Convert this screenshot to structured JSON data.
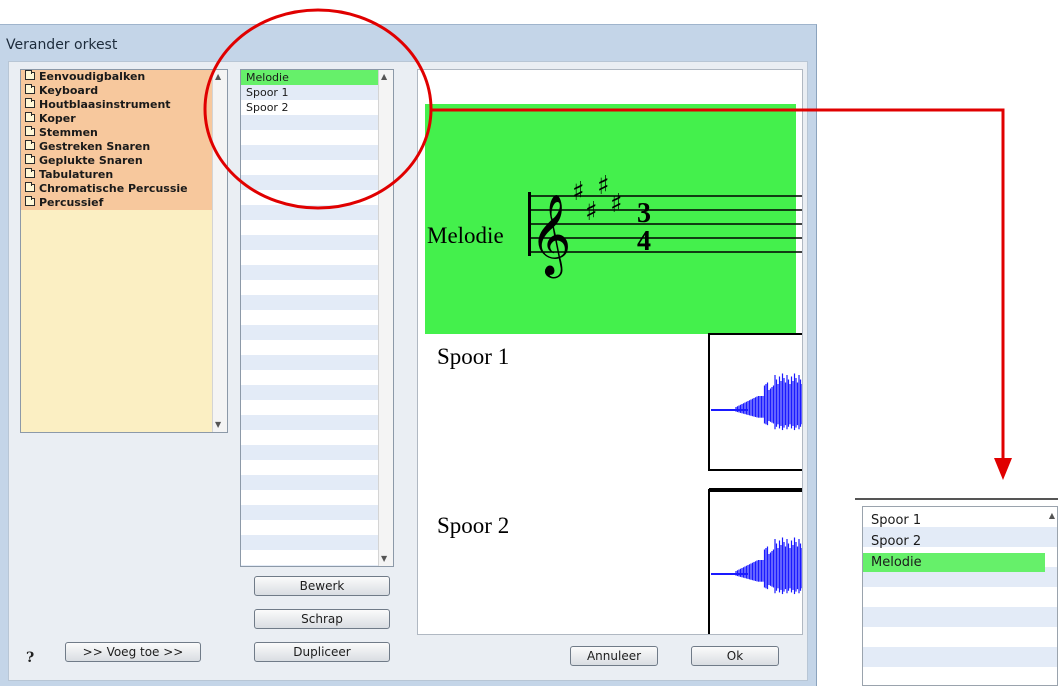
{
  "window": {
    "title": "Verander orkest"
  },
  "categories": [
    "Eenvoudigbalken",
    "Keyboard",
    "Houtblaasinstrument",
    "Koper",
    "Stemmen",
    "Gestreken Snaren",
    "Geplukte Snaren",
    "Tabulaturen",
    "Chromatische Percussie",
    "Percussief"
  ],
  "tracks": [
    {
      "label": "Melodie",
      "selected": true
    },
    {
      "label": "Spoor 1",
      "selected": false
    },
    {
      "label": "Spoor 2",
      "selected": false
    }
  ],
  "buttons": {
    "edit": "Bewerk",
    "delete": "Schrap",
    "duplicate": "Dupliceer",
    "add": ">> Voeg toe >>",
    "cancel": "Annuleer",
    "ok": "Ok",
    "help": "?"
  },
  "preview": {
    "melody_label": "Melodie",
    "time_signature_top": "3",
    "time_signature_bottom": "4",
    "track1_label": "Spoor 1",
    "track2_label": "Spoor 2",
    "melody_color": "#44f04c",
    "wave_color": "#1a1aff"
  },
  "reordered_list": [
    {
      "label": "Spoor 1",
      "selected": false
    },
    {
      "label": "Spoor 2",
      "selected": false
    },
    {
      "label": "Melodie",
      "selected": true
    }
  ],
  "annotation_color": "#e00000"
}
